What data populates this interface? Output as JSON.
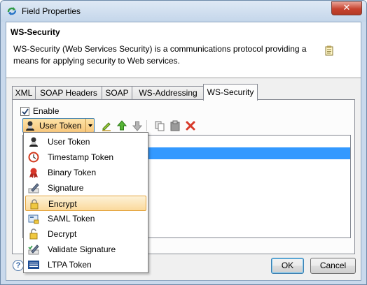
{
  "window": {
    "title": "Field Properties",
    "close_glyph": "✕"
  },
  "header": {
    "title": "WS-Security",
    "description": "WS-Security (Web Services Security) is a communications protocol providing a means for applying security to Web services."
  },
  "tabs": [
    {
      "label": "XML",
      "active": false
    },
    {
      "label": "SOAP Headers",
      "active": false
    },
    {
      "label": "SOAP",
      "active": false
    },
    {
      "label": "WS-Addressing",
      "active": false
    },
    {
      "label": "WS-Security",
      "active": true
    }
  ],
  "enable": {
    "label": "Enable",
    "checked": true
  },
  "token_combo": {
    "value": "User Token"
  },
  "toolbar_icons": [
    "edit-icon",
    "move-up-icon",
    "move-down-icon",
    "copy-icon",
    "paste-icon",
    "delete-icon"
  ],
  "dropdown": {
    "items": [
      {
        "label": "User Token",
        "icon": "user-token-icon"
      },
      {
        "label": "Timestamp Token",
        "icon": "clock-icon"
      },
      {
        "label": "Binary Token",
        "icon": "ribbon-icon"
      },
      {
        "label": "Signature",
        "icon": "pen-icon"
      },
      {
        "label": "Encrypt",
        "icon": "lock-icon",
        "selected": true
      },
      {
        "label": "SAML Token",
        "icon": "saml-card-icon"
      },
      {
        "label": "Decrypt",
        "icon": "unlock-icon"
      },
      {
        "label": "Validate Signature",
        "icon": "pen-check-icon"
      },
      {
        "label": "LTPA Token",
        "icon": "ibm-logo-icon"
      }
    ]
  },
  "buttons": {
    "ok": "OK",
    "cancel": "Cancel",
    "help_glyph": "?"
  },
  "colors": {
    "selection": "#3399ff",
    "highlight": "#fbd99b",
    "close": "#c7432f"
  }
}
